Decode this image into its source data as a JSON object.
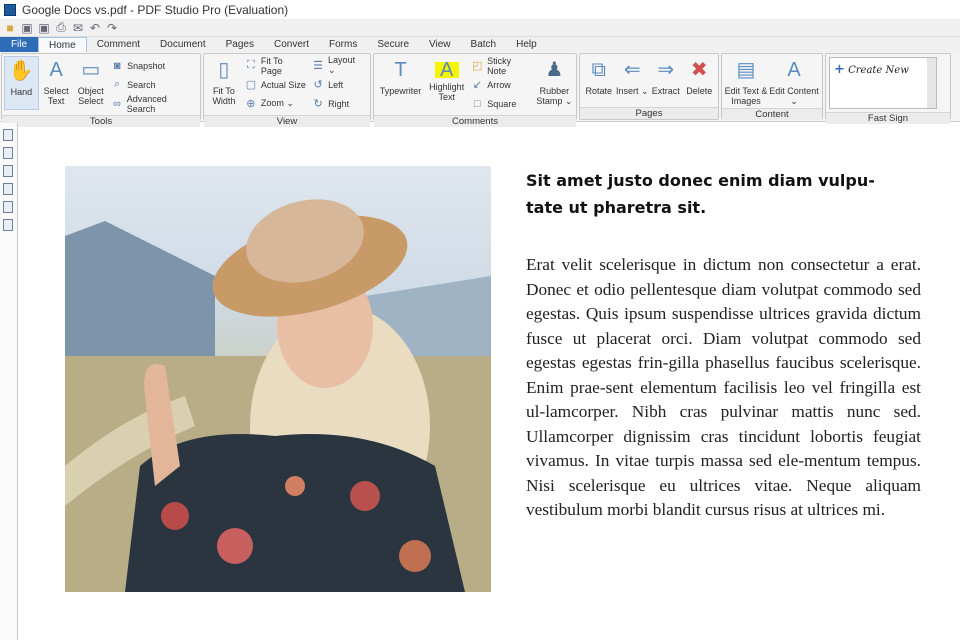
{
  "window": {
    "title": "Google Docs vs.pdf - PDF Studio Pro (Evaluation)"
  },
  "tabs": [
    "File",
    "Home",
    "Comment",
    "Document",
    "Pages",
    "Convert",
    "Forms",
    "Secure",
    "View",
    "Batch",
    "Help"
  ],
  "active_tab": "Home",
  "ribbon": {
    "tools": {
      "label": "Tools",
      "hand": "Hand",
      "select_text": "Select Text",
      "object_select": "Object Select",
      "snapshot": "Snapshot",
      "search": "Search",
      "advanced_search": "Advanced Search"
    },
    "view": {
      "label": "View",
      "fit_to_width": "Fit To Width",
      "fit_to_page": "Fit To Page",
      "actual_size": "Actual Size",
      "zoom": "Zoom ⌄",
      "layout": "Layout ⌄",
      "left": "Left",
      "right": "Right"
    },
    "comments": {
      "label": "Comments",
      "typewriter": "Typewriter",
      "highlight_text": "Highlight Text",
      "sticky_note": "Sticky Note",
      "arrow": "Arrow",
      "square": "Square",
      "rubber_stamp": "Rubber Stamp ⌄"
    },
    "pages": {
      "label": "Pages",
      "rotate": "Rotate",
      "insert": "Insert ⌄",
      "extract": "Extract",
      "delete": "Delete"
    },
    "content": {
      "label": "Content",
      "edit_text_images": "Edit Text & Images",
      "edit_content": "Edit Content ⌄"
    },
    "fast_sign": {
      "label": "Fast Sign",
      "create_new": "Create New"
    }
  },
  "document": {
    "heading": "Sit amet justo donec enim diam vulpu-tate ut pharetra sit.",
    "body": "Erat velit scelerisque in dictum non consectetur a erat. Donec et odio pellentesque diam volutpat commodo sed egestas. Quis ipsum suspendisse ultrices gravida dictum fusce ut placerat orci. Diam volutpat commodo sed egestas egestas frin-gilla phasellus faucibus scelerisque. Enim prae-sent elementum facilisis leo vel fringilla est ul-lamcorper. Nibh cras pulvinar mattis nunc sed. Ullamcorper dignissim cras tincidunt lobortis feugiat vivamus. In vitae turpis massa sed ele-mentum tempus. Nisi scelerisque eu ultrices vitae. Neque aliquam vestibulum morbi blandit cursus risus at ultrices mi."
  },
  "colors": {
    "accent": "#2d6db5",
    "highlight": "#f5f500"
  }
}
